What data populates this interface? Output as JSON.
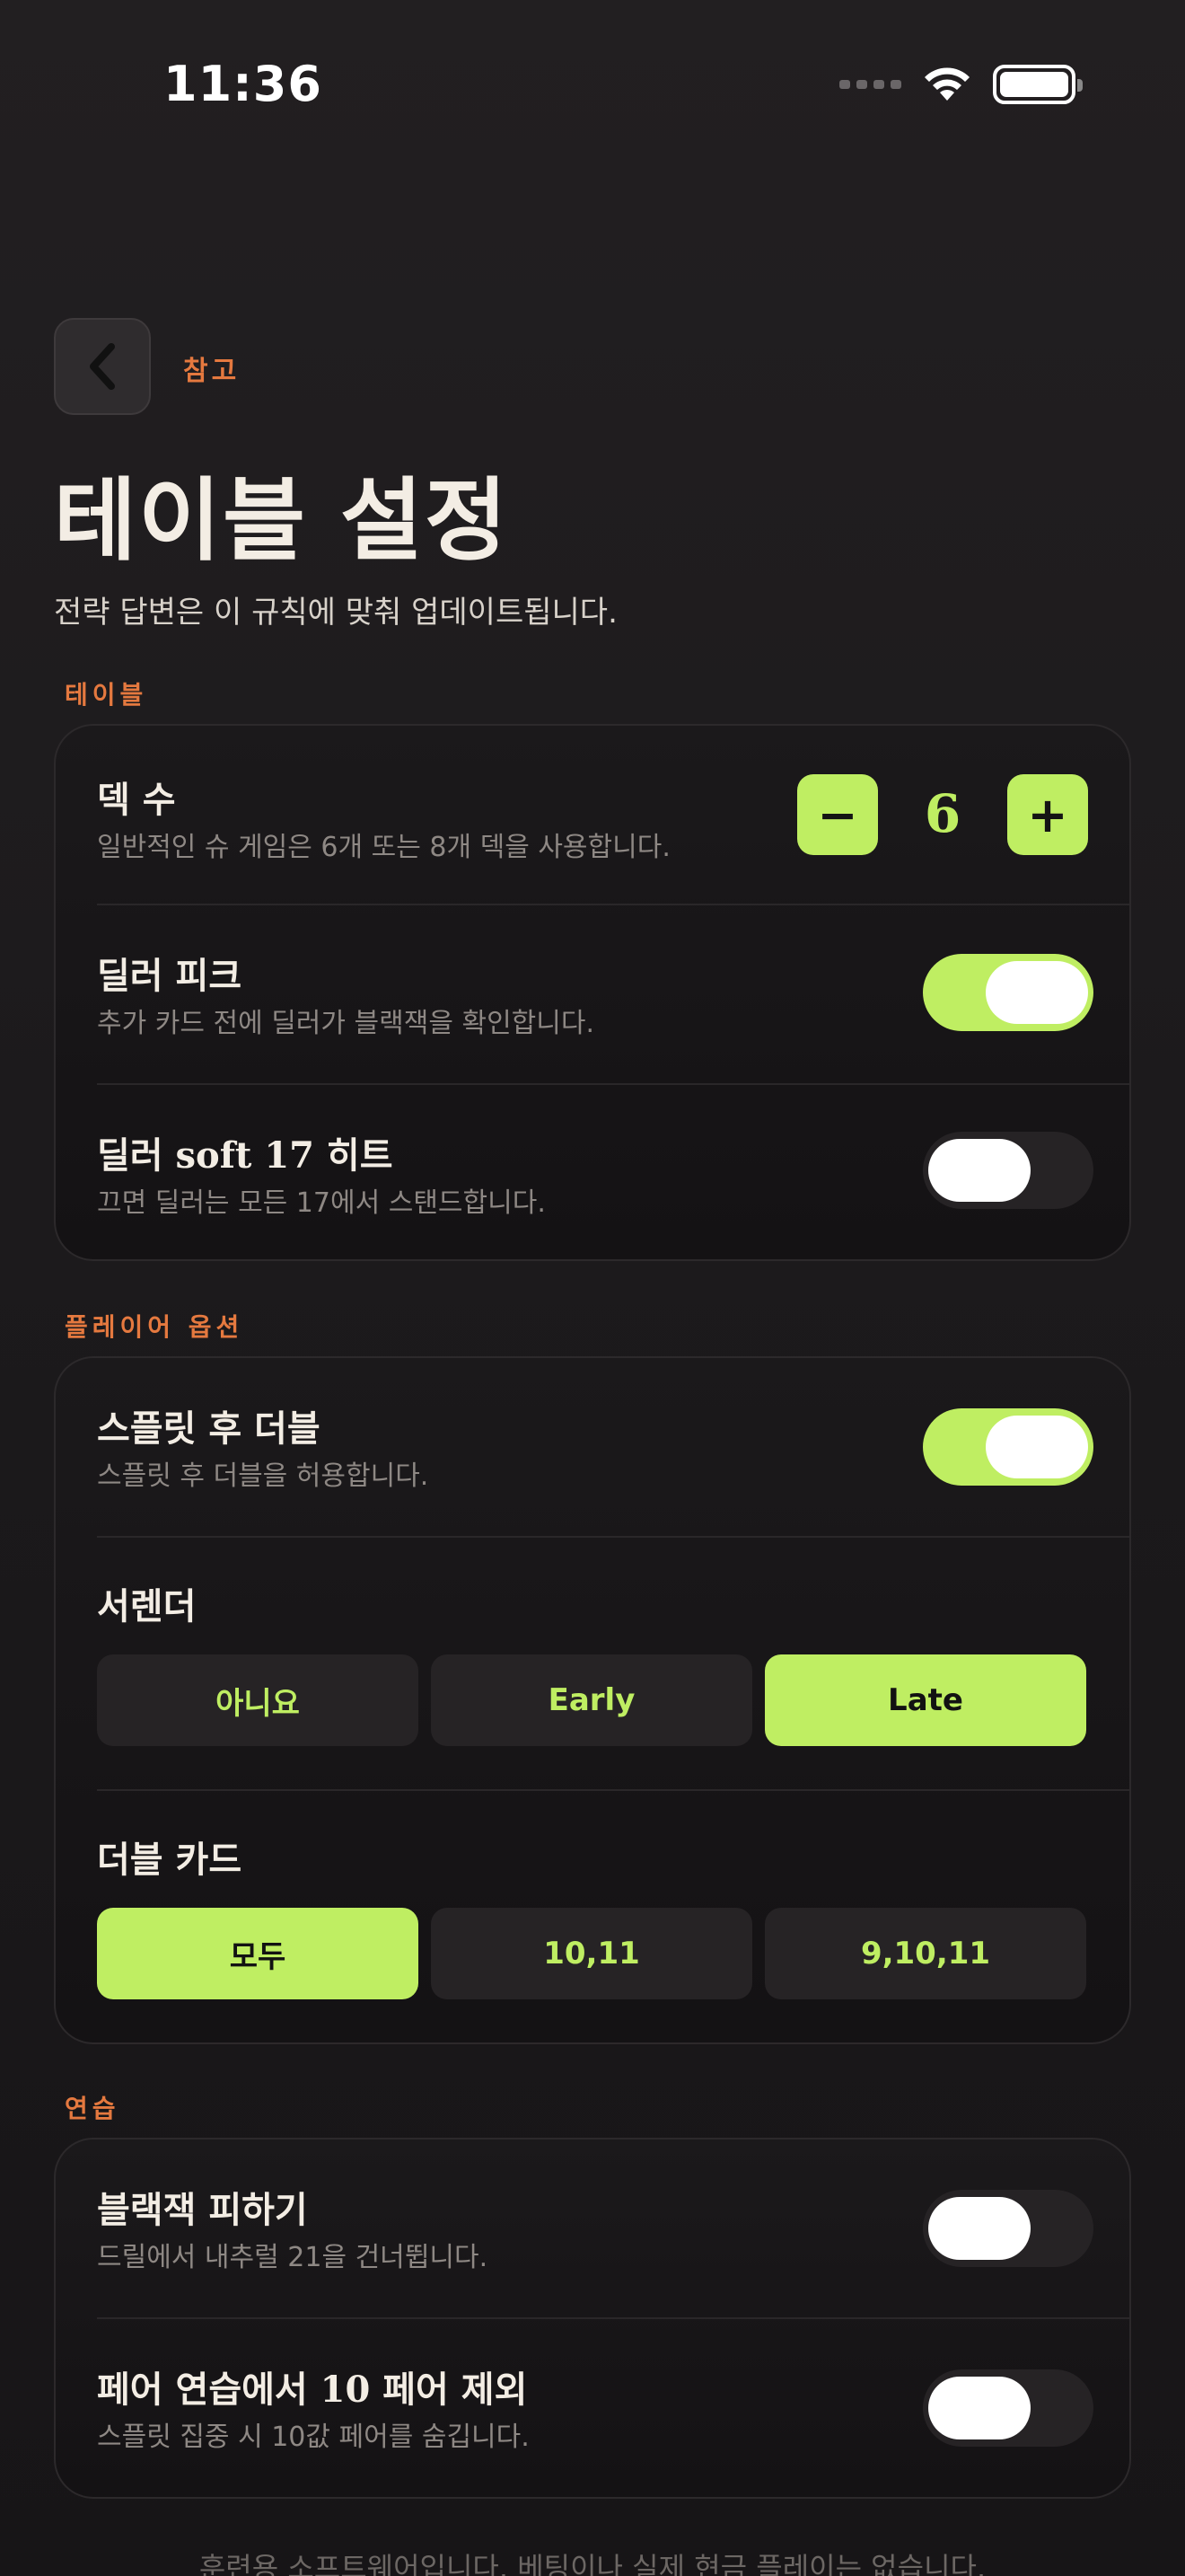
{
  "status": {
    "time": "11:36"
  },
  "nav": {
    "back_label": "참고"
  },
  "header": {
    "title": "테이블 설정",
    "subtitle": "전략 답변은 이 규칙에 맞춰 업데이트됩니다."
  },
  "sections": {
    "table": {
      "label": "테이블",
      "decks": {
        "title": "덱 수",
        "desc": "일반적인 슈 게임은 6개 또는 8개 덱을 사용합니다.",
        "value": "6",
        "minus": "−",
        "plus": "+"
      },
      "peek": {
        "title": "딜러 피크",
        "desc": "추가 카드 전에 딜러가 블랙잭을 확인합니다.",
        "on": true
      },
      "soft17": {
        "title": "딜러 soft 17 히트",
        "desc": "끄면 딜러는 모든 17에서 스탠드합니다.",
        "on": false
      }
    },
    "player": {
      "label": "플레이어 옵션",
      "das": {
        "title": "스플릿 후 더블",
        "desc": "스플릿 후 더블을 허용합니다.",
        "on": true
      },
      "surrender": {
        "title": "서렌더",
        "options": [
          "아니요",
          "Early",
          "Late"
        ],
        "selected": "Late"
      },
      "double_cards": {
        "title": "더블 카드",
        "options": [
          "모두",
          "10,11",
          "9,10,11"
        ],
        "selected": "모두"
      }
    },
    "practice": {
      "label": "연습",
      "skip_bj": {
        "title": "블랙잭 피하기",
        "desc": "드릴에서 내추럴 21을 건너뜁니다.",
        "on": false
      },
      "exclude_tens": {
        "title": "페어 연습에서 10 페어 제외",
        "desc": "스플릿 집중 시 10값 페어를 숨깁니다.",
        "on": false
      }
    }
  },
  "footer": {
    "note": "훈련용 소프트웨어입니다. 베팅이나 실제 현금 플레이는 없습니다."
  },
  "colors": {
    "accent": "#bfee62",
    "section_label": "#e5793f"
  }
}
